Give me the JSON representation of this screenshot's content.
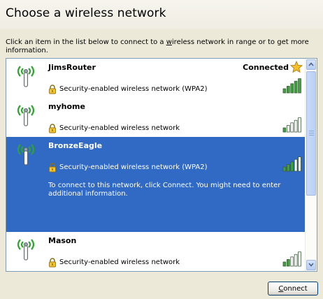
{
  "window": {
    "title": "Choose a wireless network",
    "instructions_before": "Click an item in the list below to connect to a ",
    "instructions_accel": "w",
    "instructions_after": "ireless network in range or to get more information."
  },
  "networks": [
    {
      "name": "JimsRouter",
      "status": "Connected",
      "security": "Security-enabled wireless network (WPA2)",
      "signal_bars": 5,
      "selected": false,
      "preferred": true
    },
    {
      "name": "myhome",
      "status": "",
      "security": "Security-enabled wireless network",
      "signal_bars": 1,
      "selected": false,
      "preferred": false
    },
    {
      "name": "BronzeEagle",
      "status": "",
      "security": "Security-enabled wireless network (WPA2)",
      "signal_bars": 3,
      "selected": true,
      "details": "To connect to this network, click Connect. You might need to enter additional information."
    },
    {
      "name": "Mason",
      "status": "",
      "security": "Security-enabled wireless network",
      "signal_bars": 2,
      "selected": false,
      "preferred": false
    }
  ],
  "footer": {
    "connect_label_accel": "C",
    "connect_label_rest": "onnect"
  },
  "icons": {
    "network": "wireless-antenna-icon",
    "lock": "lock-icon",
    "signal": "signal-strength-icon",
    "preferred": "star-icon",
    "scroll_up": "chevron-up-icon",
    "scroll_down": "chevron-down-icon"
  },
  "colors": {
    "selection": "#316ac5",
    "signal_on": "#3aa63a",
    "signal_off": "#ffffff",
    "wave_green": "#2fa32f",
    "window_bg": "#ece9d8"
  }
}
